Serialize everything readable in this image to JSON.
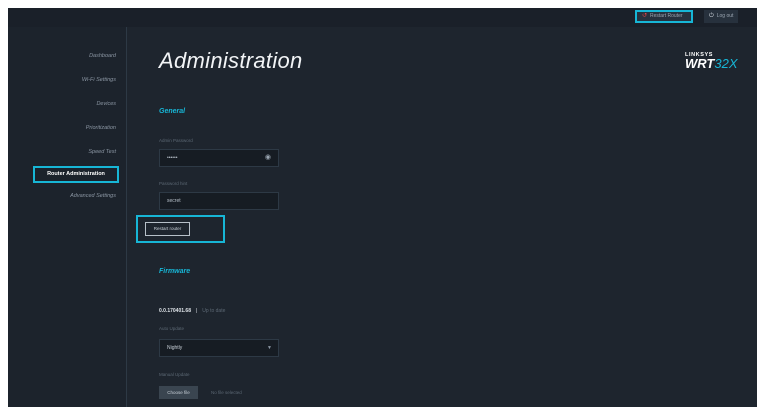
{
  "topbar": {
    "restart_label": "Restart Router",
    "logout_label": "Log out"
  },
  "sidebar": {
    "items": [
      {
        "label": "Dashboard"
      },
      {
        "label": "Wi-Fi Settings"
      },
      {
        "label": "Devices"
      },
      {
        "label": "Prioritization"
      },
      {
        "label": "Speed Test"
      },
      {
        "label": "Router Administration",
        "active": true
      },
      {
        "label": "Advanced Settings"
      }
    ]
  },
  "page": {
    "title": "Administration"
  },
  "brand": {
    "line1": "LINKSYS",
    "model_prefix": "WRT",
    "model_suffix": "32X"
  },
  "general": {
    "title": "General",
    "admin_password_label": "Admin Password",
    "admin_password_value": "••••••",
    "password_hint_label": "Password hint",
    "password_hint_value": "secret",
    "restart_router_button": "Restart router"
  },
  "firmware": {
    "title": "Firmware",
    "version": "0.0.170401.68",
    "separator": "|",
    "status": "Up to date",
    "auto_update_label": "Auto Update",
    "auto_update_value": "Nightly",
    "manual_update_label": "Manual Update",
    "choose_file_button": "Choose file",
    "no_file_text": "No file selected"
  },
  "colors": {
    "accent": "#17b6d6",
    "background": "#1e252e",
    "sidebar": "#1c232c"
  }
}
